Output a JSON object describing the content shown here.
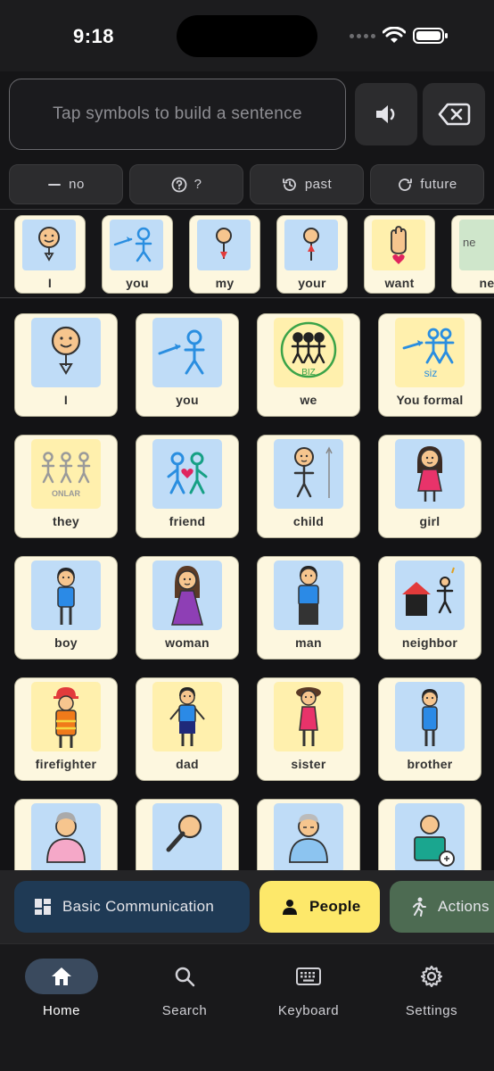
{
  "status": {
    "time": "9:18"
  },
  "composer": {
    "placeholder": "Tap symbols to build a sentence"
  },
  "modifiers": [
    {
      "label": "no",
      "icon": "minus-icon"
    },
    {
      "label": "?",
      "icon": "question-circle-icon"
    },
    {
      "label": "past",
      "icon": "history-icon"
    },
    {
      "label": "future",
      "icon": "refresh-icon"
    }
  ],
  "strip": [
    {
      "label": "I"
    },
    {
      "label": "you"
    },
    {
      "label": "my"
    },
    {
      "label": "your"
    },
    {
      "label": "want"
    },
    {
      "label": "ne"
    }
  ],
  "grid": [
    {
      "label": "I",
      "caption": ""
    },
    {
      "label": "you",
      "caption": ""
    },
    {
      "label": "we",
      "caption": "BIZ"
    },
    {
      "label": "You formal",
      "caption": "siz"
    },
    {
      "label": "they",
      "caption": "ONLAR"
    },
    {
      "label": "friend",
      "caption": ""
    },
    {
      "label": "child",
      "caption": ""
    },
    {
      "label": "girl",
      "caption": ""
    },
    {
      "label": "boy",
      "caption": ""
    },
    {
      "label": "woman",
      "caption": ""
    },
    {
      "label": "man",
      "caption": ""
    },
    {
      "label": "neighbor",
      "caption": ""
    },
    {
      "label": "firefighter",
      "caption": ""
    },
    {
      "label": "dad",
      "caption": ""
    },
    {
      "label": "sister",
      "caption": ""
    },
    {
      "label": "brother",
      "caption": ""
    }
  ],
  "categories": [
    {
      "label": "Basic Communication",
      "color": "#1f3a55"
    },
    {
      "label": "People",
      "color": "#fde86a"
    },
    {
      "label": "Actions",
      "color": "#4d6b52"
    }
  ],
  "nav": [
    {
      "label": "Home"
    },
    {
      "label": "Search"
    },
    {
      "label": "Keyboard"
    },
    {
      "label": "Settings"
    }
  ]
}
